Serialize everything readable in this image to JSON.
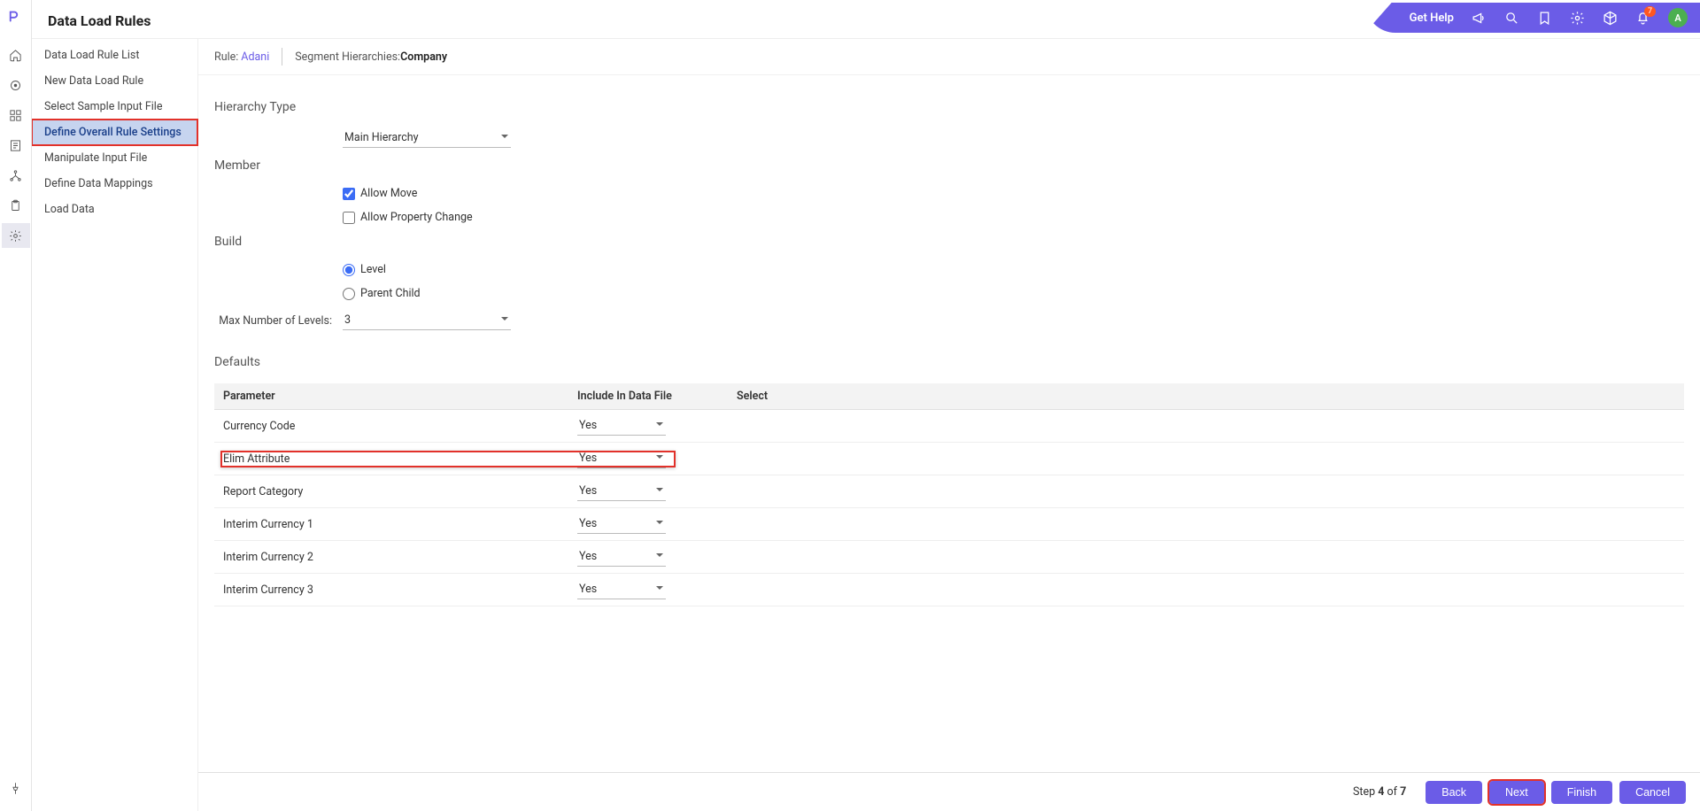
{
  "topbar": {
    "get_help": "Get Help",
    "notif_badge": "7",
    "avatar": "A"
  },
  "page_title": "Data Load Rules",
  "sidenav": {
    "items": [
      {
        "label": "Data Load Rule List"
      },
      {
        "label": "New Data Load Rule"
      },
      {
        "label": "Select Sample Input File"
      },
      {
        "label": "Define Overall Rule Settings",
        "selected": true,
        "highlighted": true
      },
      {
        "label": "Manipulate Input File"
      },
      {
        "label": "Define Data Mappings"
      },
      {
        "label": "Load Data"
      }
    ]
  },
  "breadcrumb": {
    "rule_label": "Rule:",
    "rule_value": "Adani",
    "seg_label": "Segment Hierarchies:",
    "seg_value": "Company"
  },
  "sections": {
    "hierarchy_type": {
      "title": "Hierarchy Type",
      "value": "Main Hierarchy"
    },
    "member": {
      "title": "Member",
      "allow_move": "Allow Move",
      "allow_prop": "Allow Property Change"
    },
    "build": {
      "title": "Build",
      "level": "Level",
      "parent_child": "Parent Child",
      "max_levels_label": "Max Number of Levels:",
      "max_levels_value": "3"
    },
    "defaults": {
      "title": "Defaults",
      "cols": {
        "param": "Parameter",
        "include": "Include In Data File",
        "select": "Select"
      },
      "rows": [
        {
          "param": "Currency Code",
          "include": "Yes"
        },
        {
          "param": "Elim Attribute",
          "include": "Yes",
          "highlighted": true
        },
        {
          "param": "Report Category",
          "include": "Yes"
        },
        {
          "param": "Interim Currency 1",
          "include": "Yes"
        },
        {
          "param": "Interim Currency 2",
          "include": "Yes"
        },
        {
          "param": "Interim Currency 3",
          "include": "Yes"
        }
      ]
    }
  },
  "footer": {
    "step_prefix": "Step ",
    "step_cur": "4",
    "step_mid": " of ",
    "step_total": "7",
    "back": "Back",
    "next": "Next",
    "finish": "Finish",
    "cancel": "Cancel"
  }
}
